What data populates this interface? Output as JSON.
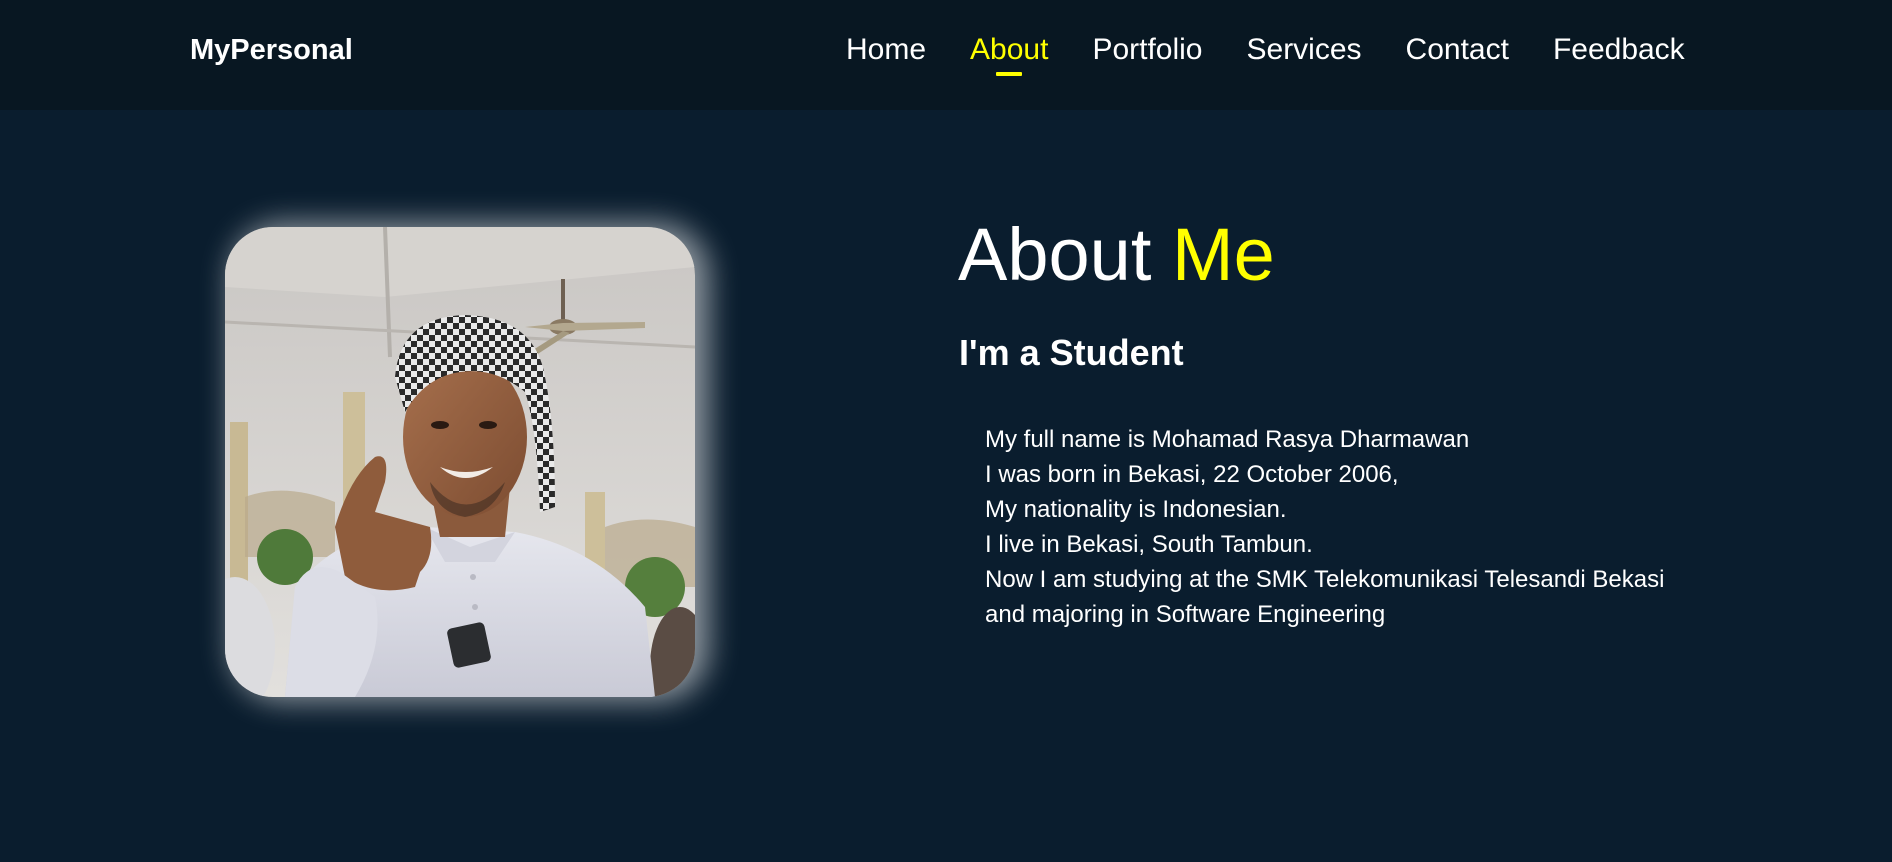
{
  "brand": "MyPersonal",
  "nav": {
    "items": [
      {
        "label": "Home"
      },
      {
        "label": "About",
        "active": true
      },
      {
        "label": "Portfolio"
      },
      {
        "label": "Services"
      },
      {
        "label": "Contact"
      },
      {
        "label": "Feedback"
      }
    ]
  },
  "about": {
    "title_part1": "About ",
    "title_part2": "Me",
    "subtitle": "I'm a Student",
    "bio_lines": [
      "My full name is Mohamad Rasya Dharmawan",
      "I was born in Bekasi, 22 October 2006,",
      "My nationality is Indonesian.",
      "I live in Bekasi, South Tambun.",
      "Now I am studying at the SMK Telekomunikasi Telesandi Bekasi",
      "and majoring in Software Engineering"
    ]
  },
  "colors": {
    "background": "#0a1d2e",
    "navbar": "#081722",
    "accent": "#ffff00",
    "text": "#ffffff"
  }
}
